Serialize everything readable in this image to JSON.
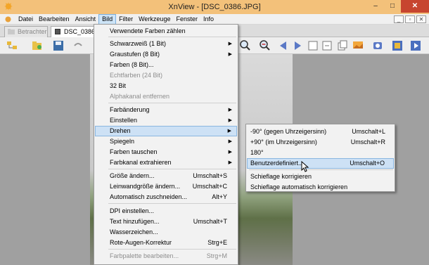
{
  "window": {
    "title": "XnView - [DSC_0386.JPG]",
    "minimize_glyph": "–",
    "maximize_glyph": "□",
    "close_glyph": "✕"
  },
  "menubar": {
    "items": [
      {
        "label": "Datei"
      },
      {
        "label": "Bearbeiten"
      },
      {
        "label": "Ansicht"
      },
      {
        "label": "Bild"
      },
      {
        "label": "Filter"
      },
      {
        "label": "Werkzeuge"
      },
      {
        "label": "Fenster"
      },
      {
        "label": "Info"
      }
    ],
    "active_index": 3,
    "mdi_minimize": "_",
    "mdi_restore": "▫",
    "mdi_close": "✕"
  },
  "tabs": [
    {
      "label": "Betrachter",
      "active": false
    },
    {
      "label": "DSC_0386.JP",
      "active": true
    }
  ],
  "image_menu": {
    "items": [
      {
        "label": "Verwendete Farben zählen",
        "shortcut": "",
        "submenu": false,
        "disabled": false
      },
      {
        "label": "Schwarzweiß (1 Bit)",
        "shortcut": "",
        "submenu": true,
        "disabled": false
      },
      {
        "label": "Graustufen (8 Bit)",
        "shortcut": "",
        "submenu": true,
        "disabled": false
      },
      {
        "label": "Farben (8 Bit)...",
        "shortcut": "",
        "submenu": false,
        "disabled": false
      },
      {
        "label": "Echtfarben (24 Bit)",
        "shortcut": "",
        "submenu": false,
        "disabled": true
      },
      {
        "label": "32 Bit",
        "shortcut": "",
        "submenu": false,
        "disabled": false
      },
      {
        "label": "Alphakanal entfernen",
        "shortcut": "",
        "submenu": false,
        "disabled": true
      },
      {
        "label": "Farbänderung",
        "shortcut": "",
        "submenu": true,
        "disabled": false
      },
      {
        "label": "Einstellen",
        "shortcut": "",
        "submenu": true,
        "disabled": false
      },
      {
        "label": "Drehen",
        "shortcut": "",
        "submenu": true,
        "disabled": false
      },
      {
        "label": "Spiegeln",
        "shortcut": "",
        "submenu": true,
        "disabled": false
      },
      {
        "label": "Farben tauschen",
        "shortcut": "",
        "submenu": true,
        "disabled": false
      },
      {
        "label": "Farbkanal extrahieren",
        "shortcut": "",
        "submenu": true,
        "disabled": false
      },
      {
        "label": "Größe ändern...",
        "shortcut": "Umschalt+S",
        "submenu": false,
        "disabled": false
      },
      {
        "label": "Leinwandgröße ändern...",
        "shortcut": "Umschalt+C",
        "submenu": false,
        "disabled": false
      },
      {
        "label": "Automatisch zuschneiden...",
        "shortcut": "Alt+Y",
        "submenu": false,
        "disabled": false
      },
      {
        "label": "DPI einstellen...",
        "shortcut": "",
        "submenu": false,
        "disabled": false
      },
      {
        "label": "Text hinzufügen...",
        "shortcut": "Umschalt+T",
        "submenu": false,
        "disabled": false
      },
      {
        "label": "Wasserzeichen...",
        "shortcut": "",
        "submenu": false,
        "disabled": false
      },
      {
        "label": "Rote-Augen-Korrektur",
        "shortcut": "Strg+E",
        "submenu": false,
        "disabled": false
      },
      {
        "label": "Farbpalette bearbeiten...",
        "shortcut": "Strg+M",
        "submenu": false,
        "disabled": true
      }
    ],
    "highlighted_index": 9,
    "submenu_arrow": "▶"
  },
  "rotate_submenu": {
    "items": [
      {
        "label": "-90° (gegen Uhrzeigersinn)",
        "shortcut": "Umschalt+L"
      },
      {
        "label": "+90° (im Uhrzeigersinn)",
        "shortcut": "Umschalt+R"
      },
      {
        "label": "180°",
        "shortcut": ""
      },
      {
        "label": "Benutzerdefiniert...",
        "shortcut": "Umschalt+O"
      },
      {
        "label": "Schieflage korrigieren",
        "shortcut": ""
      },
      {
        "label": "Schieflage automatisch korrigieren",
        "shortcut": ""
      }
    ],
    "highlighted_index": 3
  }
}
